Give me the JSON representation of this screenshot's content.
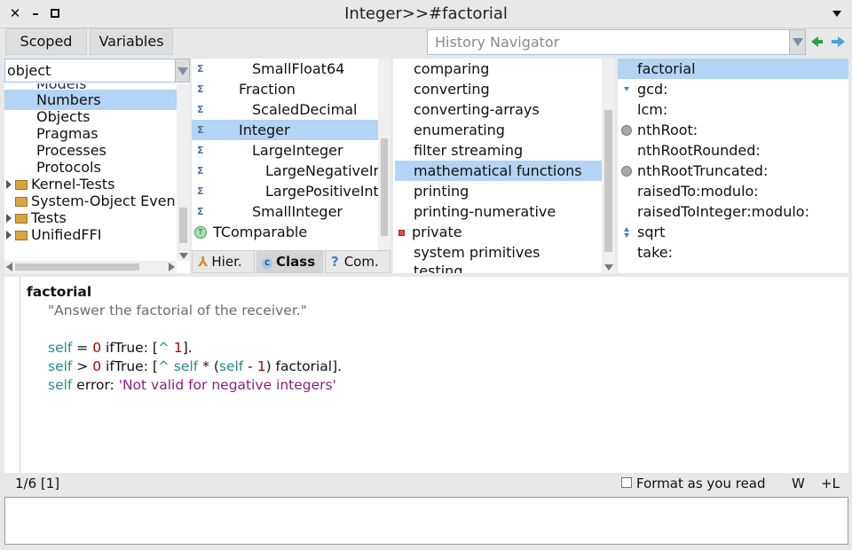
{
  "window": {
    "title": "Integer>>#factorial"
  },
  "toolbar": {
    "scoped": "Scoped",
    "variables": "Variables",
    "history_placeholder": "History Navigator"
  },
  "packages": {
    "filter": "object",
    "partial_top": "Models",
    "items": [
      "Numbers",
      "Objects",
      "Pragmas",
      "Processes",
      "Protocols",
      "Kernel-Tests",
      "System-Object Even",
      "Tests",
      "UnifiedFFI"
    ]
  },
  "classes": {
    "items": [
      "SmallFloat64",
      "Fraction",
      "ScaledDecimal",
      "Integer",
      "LargeInteger",
      "LargeNegativeIn",
      "LargePositiveInt",
      "SmallInteger",
      "TComparable"
    ],
    "tabs": {
      "hier": "Hier.",
      "class": "Class",
      "com": "Com."
    }
  },
  "protocols": {
    "items": [
      "comparing",
      "converting",
      "converting-arrays",
      "enumerating",
      "filter streaming",
      "mathematical functions",
      "printing",
      "printing-numerative",
      "private",
      "system primitives",
      "testing"
    ]
  },
  "methods": {
    "items": [
      "factorial",
      "gcd:",
      "lcm:",
      "nthRoot:",
      "nthRootRounded:",
      "nthRootTruncated:",
      "raisedTo:modulo:",
      "raisedToInteger:modulo:",
      "sqrt",
      "take:"
    ]
  },
  "code": {
    "selector": "factorial",
    "comment": "\"Answer the factorial of the receiver.\"",
    "t": {
      "self": "self",
      "eq": " = ",
      "zero": "0",
      "iftrue": " ifTrue: [",
      "caret": "^",
      "one": "1",
      "close1": "].",
      "gt": " > ",
      "times": " * (",
      "minus": " - ",
      "close2": ") factorial].",
      "error": " error: ",
      "errmsg": "'Not valid for negative integers'",
      "sp": " "
    }
  },
  "status": {
    "position": "1/6 [1]",
    "format": "Format as you read",
    "w": "W",
    "l": "+L"
  }
}
